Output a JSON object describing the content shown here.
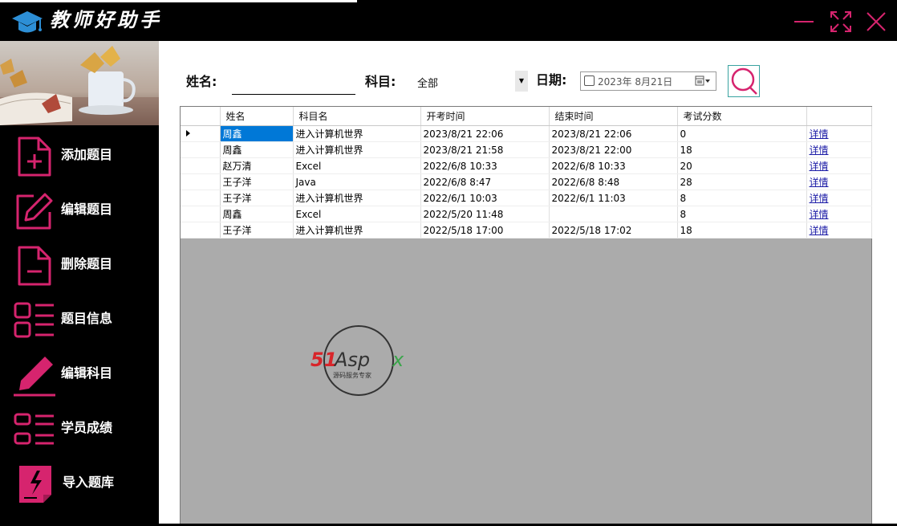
{
  "app": {
    "title": "教师好助手"
  },
  "sidebar": {
    "items": [
      {
        "label": "添加题目",
        "icon": "file-plus-icon"
      },
      {
        "label": "编辑题目",
        "icon": "edit-icon"
      },
      {
        "label": "删除题目",
        "icon": "file-minus-icon"
      },
      {
        "label": "题目信息",
        "icon": "list-icon"
      },
      {
        "label": "编辑科目",
        "icon": "pen-icon"
      },
      {
        "label": "学员成绩",
        "icon": "list-icon"
      },
      {
        "label": "导入题库",
        "icon": "import-icon"
      }
    ]
  },
  "filters": {
    "name_label": "姓名:",
    "name_value": "",
    "subject_label": "科目:",
    "subject_value": "全部",
    "date_label": "日期:",
    "date_value": "2023年  8月21日"
  },
  "table": {
    "columns": [
      "姓名",
      "科目名",
      "开考时间",
      "结束时间",
      "考试分数",
      ""
    ],
    "rows": [
      {
        "name": "周鑫",
        "subject": "进入计算机世界",
        "start": "2023/8/21 22:06",
        "end": "2023/8/21 22:06",
        "score": "0",
        "action": "详情"
      },
      {
        "name": "周鑫",
        "subject": "进入计算机世界",
        "start": "2023/8/21 21:58",
        "end": "2023/8/21 22:00",
        "score": "18",
        "action": "详情"
      },
      {
        "name": "赵万清",
        "subject": "Excel",
        "start": "2022/6/8 10:33",
        "end": "2022/6/8 10:33",
        "score": "20",
        "action": "详情"
      },
      {
        "name": "王子洋",
        "subject": "Java",
        "start": "2022/6/8 8:47",
        "end": "2022/6/8 8:48",
        "score": "28",
        "action": "详情"
      },
      {
        "name": "王子洋",
        "subject": "进入计算机世界",
        "start": "2022/6/1 10:03",
        "end": "2022/6/1 11:03",
        "score": "8",
        "action": "详情"
      },
      {
        "name": "周鑫",
        "subject": "Excel",
        "start": "2022/5/20 11:48",
        "end": "",
        "score": "8",
        "action": "详情"
      },
      {
        "name": "王子洋",
        "subject": "进入计算机世界",
        "start": "2022/5/18 17:00",
        "end": "2022/5/18 17:02",
        "score": "18",
        "action": "详情"
      }
    ]
  },
  "watermark": {
    "brand_51": "51",
    "brand_as": "Asp",
    "brand_x": "x",
    "tagline": "源码服务专家"
  },
  "colors": {
    "accent": "#d6246e",
    "selection": "#0078d7",
    "link": "#1a1aa6",
    "grid_background": "#ababab"
  }
}
